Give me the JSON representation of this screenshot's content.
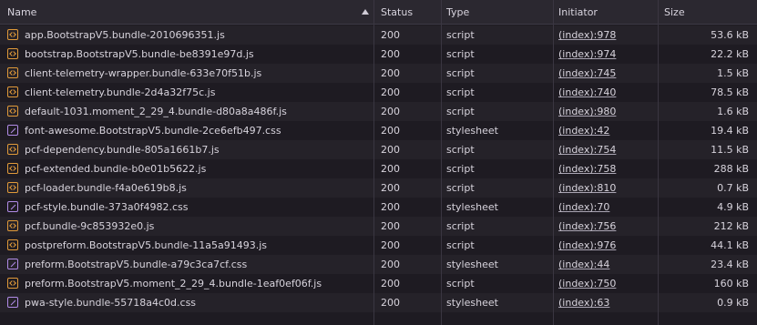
{
  "columns": {
    "name": "Name",
    "status": "Status",
    "type": "Type",
    "initiator": "Initiator",
    "size": "Size"
  },
  "sort": {
    "column": "name",
    "direction": "ascending",
    "icon": "sort-up-icon"
  },
  "colors": {
    "script_icon": "#e09a3a",
    "stylesheet_icon": "#b08be6",
    "header_bg": "#2b2830",
    "row_bg": "#1e1b22",
    "row_alt_bg": "#252229"
  },
  "rows": [
    {
      "name": "app.BootstrapV5.bundle-2010696351.js",
      "status": "200",
      "type": "script",
      "initiator": "(index):978",
      "size": "53.6 kB",
      "icon": "script-icon"
    },
    {
      "name": "bootstrap.BootstrapV5.bundle-be8391e97d.js",
      "status": "200",
      "type": "script",
      "initiator": "(index):974",
      "size": "22.2 kB",
      "icon": "script-icon"
    },
    {
      "name": "client-telemetry-wrapper.bundle-633e70f51b.js",
      "status": "200",
      "type": "script",
      "initiator": "(index):745",
      "size": "1.5 kB",
      "icon": "script-icon"
    },
    {
      "name": "client-telemetry.bundle-2d4a32f75c.js",
      "status": "200",
      "type": "script",
      "initiator": "(index):740",
      "size": "78.5 kB",
      "icon": "script-icon"
    },
    {
      "name": "default-1031.moment_2_29_4.bundle-d80a8a486f.js",
      "status": "200",
      "type": "script",
      "initiator": "(index):980",
      "size": "1.6 kB",
      "icon": "script-icon"
    },
    {
      "name": "font-awesome.BootstrapV5.bundle-2ce6efb497.css",
      "status": "200",
      "type": "stylesheet",
      "initiator": "(index):42",
      "size": "19.4 kB",
      "icon": "stylesheet-icon"
    },
    {
      "name": "pcf-dependency.bundle-805a1661b7.js",
      "status": "200",
      "type": "script",
      "initiator": "(index):754",
      "size": "11.5 kB",
      "icon": "script-icon"
    },
    {
      "name": "pcf-extended.bundle-b0e01b5622.js",
      "status": "200",
      "type": "script",
      "initiator": "(index):758",
      "size": "288 kB",
      "icon": "script-icon"
    },
    {
      "name": "pcf-loader.bundle-f4a0e619b8.js",
      "status": "200",
      "type": "script",
      "initiator": "(index):810",
      "size": "0.7 kB",
      "icon": "script-icon"
    },
    {
      "name": "pcf-style.bundle-373a0f4982.css",
      "status": "200",
      "type": "stylesheet",
      "initiator": "(index):70",
      "size": "4.9 kB",
      "icon": "stylesheet-icon"
    },
    {
      "name": "pcf.bundle-9c853932e0.js",
      "status": "200",
      "type": "script",
      "initiator": "(index):756",
      "size": "212 kB",
      "icon": "script-icon"
    },
    {
      "name": "postpreform.BootstrapV5.bundle-11a5a91493.js",
      "status": "200",
      "type": "script",
      "initiator": "(index):976",
      "size": "44.1 kB",
      "icon": "script-icon"
    },
    {
      "name": "preform.BootstrapV5.bundle-a79c3ca7cf.css",
      "status": "200",
      "type": "stylesheet",
      "initiator": "(index):44",
      "size": "23.4 kB",
      "icon": "stylesheet-icon"
    },
    {
      "name": "preform.BootstrapV5.moment_2_29_4.bundle-1eaf0ef06f.js",
      "status": "200",
      "type": "script",
      "initiator": "(index):750",
      "size": "160 kB",
      "icon": "script-icon"
    },
    {
      "name": "pwa-style.bundle-55718a4c0d.css",
      "status": "200",
      "type": "stylesheet",
      "initiator": "(index):63",
      "size": "0.9 kB",
      "icon": "stylesheet-icon"
    }
  ]
}
